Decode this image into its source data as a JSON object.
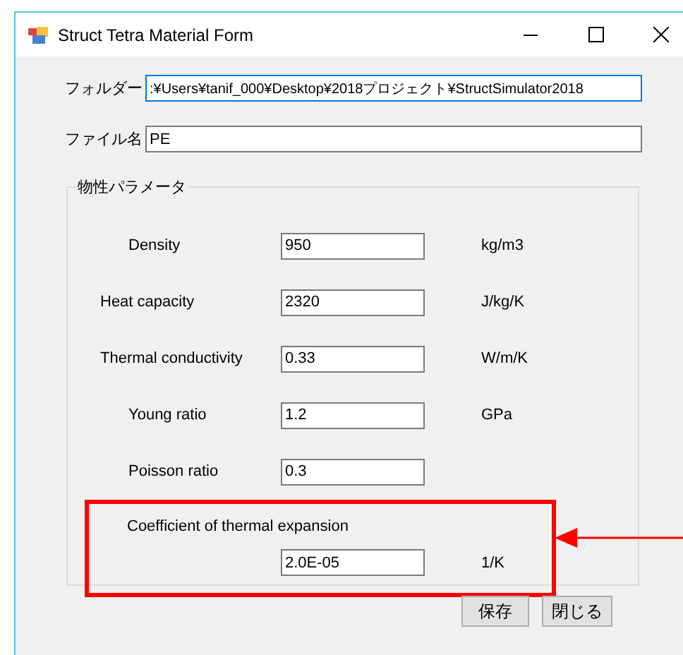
{
  "window": {
    "title": "Struct Tetra Material Form"
  },
  "folder": {
    "label": "フォルダー",
    "value": ":¥Users¥tanif_000¥Desktop¥2018プロジェクト¥StructSimulator2018"
  },
  "file": {
    "label": "ファイル名",
    "value": "PE"
  },
  "group": {
    "title": "物性パラメータ",
    "properties": [
      {
        "kind": "inline",
        "label": "Density",
        "value": "950",
        "unit": "kg/m3",
        "highlighted": false
      },
      {
        "kind": "inline",
        "label": "Heat capacity",
        "value": "2320",
        "unit": "J/kg/K",
        "highlighted": false
      },
      {
        "kind": "inline",
        "label": "Thermal conductivity",
        "value": "0.33",
        "unit": "W/m/K",
        "highlighted": false
      },
      {
        "kind": "inline",
        "label": "Young ratio",
        "value": "1.2",
        "unit": "GPa",
        "highlighted": false
      },
      {
        "kind": "inline",
        "label": "Poisson ratio",
        "value": "0.3",
        "highlighted": false
      },
      {
        "kind": "stacked",
        "label": "Coefficient of thermal expansion",
        "value": "2.0E-05",
        "unit": "1/K",
        "highlighted": true
      }
    ]
  },
  "buttons": [
    "保存",
    "閉じる"
  ]
}
